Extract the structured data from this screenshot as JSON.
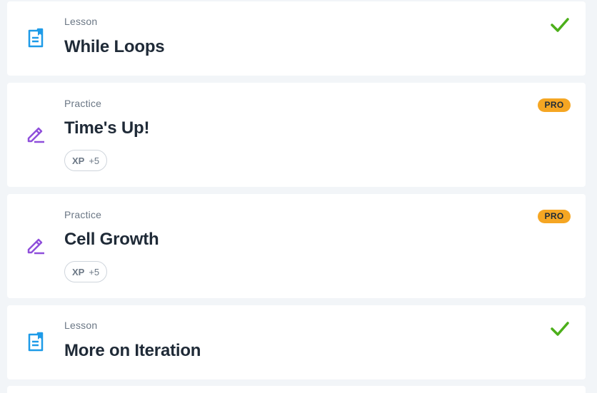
{
  "items": [
    {
      "type": "Lesson",
      "title": "While Loops",
      "completed": true,
      "icon": "lesson-document-icon"
    },
    {
      "type": "Practice",
      "title": "Time's Up!",
      "badge": "PRO",
      "xp_label": "XP",
      "xp_value": "+5",
      "icon": "pencil-practice-icon"
    },
    {
      "type": "Practice",
      "title": "Cell Growth",
      "badge": "PRO",
      "xp_label": "XP",
      "xp_value": "+5",
      "icon": "pencil-practice-icon"
    },
    {
      "type": "Lesson",
      "title": "More on Iteration",
      "completed": true,
      "icon": "lesson-document-icon"
    }
  ],
  "colors": {
    "background": "#f2f5f8",
    "lesson_icon": "#1e9be8",
    "practice_icon": "#8f4fdb",
    "check": "#4caf1a",
    "pro_badge": "#f5a623",
    "title_text": "#1f2a37",
    "muted_text": "#6b7785"
  }
}
